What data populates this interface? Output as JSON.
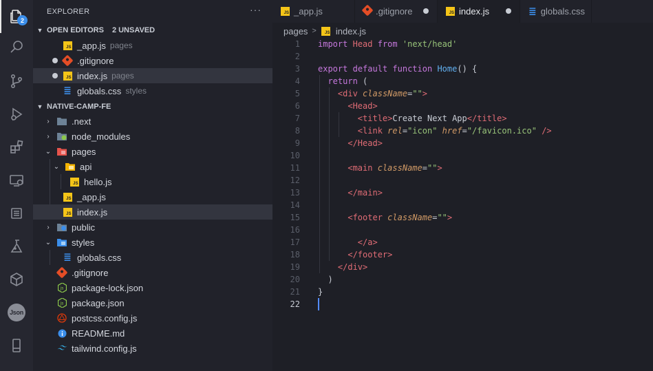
{
  "activity_bar": {
    "items": [
      {
        "icon": "explorer-icon",
        "badge": "2"
      },
      {
        "icon": "search-icon"
      },
      {
        "icon": "source-control-icon"
      },
      {
        "icon": "run-debug-icon"
      },
      {
        "icon": "extensions-icon"
      },
      {
        "icon": "remote-explorer-icon"
      },
      {
        "icon": "notes-icon"
      },
      {
        "icon": "testing-icon"
      },
      {
        "icon": "cube-icon"
      },
      {
        "icon": "json-icon",
        "label": "Json"
      },
      {
        "icon": "phone-icon"
      }
    ]
  },
  "sidebar": {
    "title": "EXPLORER",
    "more": "···",
    "open_editors": {
      "label": "OPEN EDITORS",
      "badge": "2 UNSAVED",
      "items": [
        {
          "name": "_app.js",
          "desc": "pages",
          "icon": "js-file-icon",
          "dirty": false,
          "selected": false
        },
        {
          "name": ".gitignore",
          "desc": "",
          "icon": "git-icon",
          "dirty": true,
          "selected": false
        },
        {
          "name": "index.js",
          "desc": "pages",
          "icon": "js-file-icon",
          "dirty": true,
          "selected": true
        },
        {
          "name": "globals.css",
          "desc": "styles",
          "icon": "css-file-icon",
          "dirty": false,
          "selected": false
        }
      ]
    },
    "project": {
      "label": "NATIVE-CAMP-FE",
      "tree": [
        {
          "name": ".next",
          "type": "folder",
          "open": false,
          "depth": 0,
          "icon": "folder-icon"
        },
        {
          "name": "node_modules",
          "type": "folder",
          "open": false,
          "depth": 0,
          "icon": "node-folder-icon"
        },
        {
          "name": "pages",
          "type": "folder",
          "open": true,
          "depth": 0,
          "icon": "pages-folder-icon"
        },
        {
          "name": "api",
          "type": "folder",
          "open": true,
          "depth": 1,
          "icon": "api-folder-icon"
        },
        {
          "name": "hello.js",
          "type": "file",
          "depth": 2,
          "icon": "js-file-icon"
        },
        {
          "name": "_app.js",
          "type": "file",
          "depth": 1,
          "icon": "js-file-icon"
        },
        {
          "name": "index.js",
          "type": "file",
          "depth": 1,
          "icon": "js-file-icon",
          "selected": true
        },
        {
          "name": "public",
          "type": "folder",
          "open": false,
          "depth": 0,
          "icon": "public-folder-icon"
        },
        {
          "name": "styles",
          "type": "folder",
          "open": true,
          "depth": 0,
          "icon": "styles-folder-icon"
        },
        {
          "name": "globals.css",
          "type": "file",
          "depth": 1,
          "icon": "css-file-icon"
        },
        {
          "name": ".gitignore",
          "type": "file",
          "depth": 0,
          "icon": "git-icon"
        },
        {
          "name": "package-lock.json",
          "type": "file",
          "depth": 0,
          "icon": "node-file-icon"
        },
        {
          "name": "package.json",
          "type": "file",
          "depth": 0,
          "icon": "node-file-icon"
        },
        {
          "name": "postcss.config.js",
          "type": "file",
          "depth": 0,
          "icon": "postcss-icon"
        },
        {
          "name": "README.md",
          "type": "file",
          "depth": 0,
          "icon": "info-icon"
        },
        {
          "name": "tailwind.config.js",
          "type": "file",
          "depth": 0,
          "icon": "tailwind-icon"
        }
      ]
    }
  },
  "tabs": [
    {
      "label": "_app.js",
      "icon": "js-file-icon",
      "active": false,
      "dirty": false
    },
    {
      "label": ".gitignore",
      "icon": "git-icon",
      "active": false,
      "dirty": true
    },
    {
      "label": "index.js",
      "icon": "js-file-icon",
      "active": true,
      "dirty": true
    },
    {
      "label": "globals.css",
      "icon": "css-file-icon",
      "active": false,
      "dirty": false
    }
  ],
  "breadcrumb": {
    "folder": "pages",
    "separator": ">",
    "file": "index.js"
  },
  "editor": {
    "current_line": 22,
    "lines": [
      "import Head from 'next/head'",
      "",
      "export default function Home() {",
      "  return (",
      "    <div className=\"\">",
      "      <Head>",
      "        <title>Create Next App</title>",
      "        <link rel=\"icon\" href=\"/favicon.ico\" />",
      "      </Head>",
      "",
      "      <main className=\"\">",
      "",
      "      </main>",
      "",
      "      <footer className=\"\">",
      "",
      "        </a>",
      "      </footer>",
      "    </div>",
      "  )",
      "}",
      ""
    ]
  },
  "colors": {
    "activity_bar_bg": "#262730",
    "sidebar_bg": "#21222a",
    "editor_bg": "#1e1f26",
    "keyword": "#c678dd",
    "function": "#61afef",
    "string": "#98c379",
    "tag": "#e06c75",
    "attribute": "#d19a66",
    "js_icon": "#f5c518",
    "css_icon": "#3b8eea",
    "git_icon": "#e44d26"
  }
}
